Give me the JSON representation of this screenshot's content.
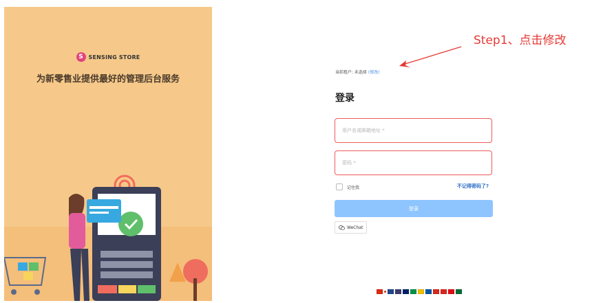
{
  "brand": {
    "logo_letter": "S",
    "name": "SENSING STORE",
    "tagline": "为新零售业提供最好的管理后台服务"
  },
  "annotation": {
    "text": "Step1、点击修改",
    "color": "#e53935"
  },
  "login": {
    "tenant_prefix": "当前租户: 未选择",
    "tenant_edit": "(修改)",
    "title": "登录",
    "username_placeholder": "用户名或邮箱地址 *",
    "password_placeholder": "密码 *",
    "remember_label": "记住我",
    "forgot_label": "不记得密码了?",
    "submit_label": "登录",
    "wechat_label": "WeChat"
  },
  "colors": {
    "panel_bg": "#f6c98a",
    "error_border": "#ef5a5a",
    "button_bg": "#8ec5ff",
    "link": "#2f6fc8"
  },
  "language_flags": [
    {
      "name": "flag-cn",
      "color": "#de2910"
    },
    {
      "name": "flag-jp",
      "color": "#ffffff"
    },
    {
      "name": "flag-nl",
      "color": "#21468b"
    },
    {
      "name": "flag-us",
      "color": "#3c3b6e"
    },
    {
      "name": "flag-gb",
      "color": "#012169"
    },
    {
      "name": "flag-it",
      "color": "#009246"
    },
    {
      "name": "flag-es",
      "color": "#f1bf00"
    },
    {
      "name": "flag-fr",
      "color": "#0055a4"
    },
    {
      "name": "flag-ru",
      "color": "#d52b1e"
    },
    {
      "name": "flag-vn",
      "color": "#da251d"
    },
    {
      "name": "flag-tr",
      "color": "#e30a17"
    },
    {
      "name": "flag-sa",
      "color": "#006c35"
    }
  ]
}
